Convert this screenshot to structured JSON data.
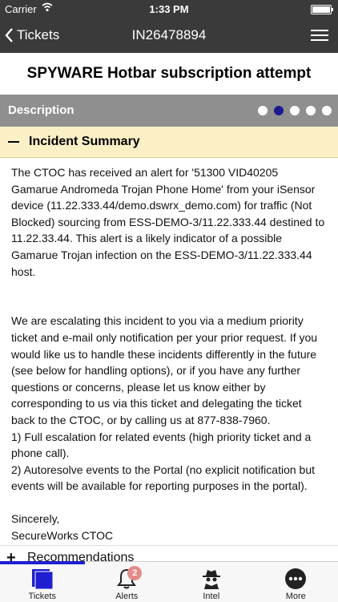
{
  "status_bar": {
    "carrier": "Carrier",
    "time": "1:33 PM",
    "battery_level": 1.0
  },
  "nav": {
    "back_label": "Tickets",
    "title": "IN26478894"
  },
  "page_title": "SPYWARE Hotbar subscription attempt",
  "section": {
    "label": "Description",
    "pager_count": 5,
    "pager_active_index": 1
  },
  "incident_summary": {
    "header": "Incident Summary",
    "text": "The CTOC has received an alert for '51300 VID40205\nGamarue Andromeda Trojan Phone Home' from your iSensor\ndevice (11.22.333.44/demo.dswrx_demo.com) for traffic (Not\nBlocked) sourcing from ESS-DEMO-3/11.22.333.44 destined to\n11.22.33.44. This alert is a likely indicator of a possible\nGamarue Trojan infection on the ESS-DEMO-3/11.22.333.44\nhost.\n\n\nWe are escalating this incident to you via a medium priority\nticket and e-mail only notification per your prior request. If you\nwould like us to handle these incidents differently in the future\n(see below for handling options), or if you have any further\nquestions or concerns, please let us know either by\ncorresponding to us via this ticket and delegating the ticket\nback to the CTOC, or by calling us at 877-838-7960.\n1) Full escalation for related events (high priority ticket and a\nphone call).\n2) Autoresolve events to the Portal (no explicit notification but\nevents will be available for reporting purposes in the portal).\n\nSincerely,\nSecureWorks CTOC"
  },
  "recommendations": {
    "label": "Recommendations"
  },
  "tabs": [
    {
      "label": "Tickets",
      "icon": "tickets-icon",
      "active": true
    },
    {
      "label": "Alerts",
      "icon": "bell-icon",
      "badge": "2"
    },
    {
      "label": "Intel",
      "icon": "spy-icon"
    },
    {
      "label": "More",
      "icon": "more-icon"
    }
  ],
  "colors": {
    "bar": "#3a3a3a",
    "section": "#8f8f8f",
    "accordion": "#fbefc5",
    "accent": "#1f1fd0",
    "badge": "#e58a8a"
  }
}
